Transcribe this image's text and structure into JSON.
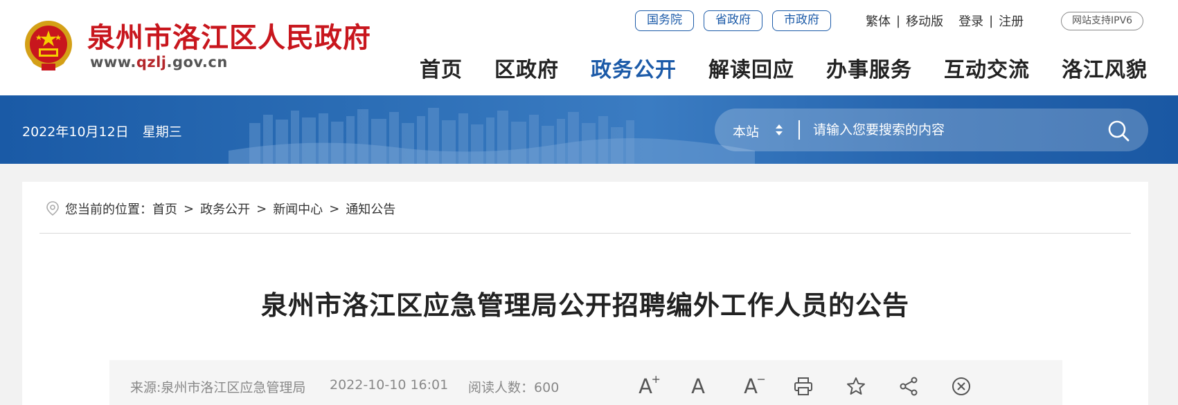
{
  "header": {
    "site_name": "泉州市洛江区人民政府",
    "site_url_prefix": "www.",
    "site_url_accent": "qzlj",
    "site_url_suffix": ".gov.cn",
    "gov_links": [
      "国务院",
      "省政府",
      "市政府"
    ],
    "util_links": {
      "traditional": "繁体",
      "mobile": "移动版",
      "login": "登录",
      "register": "注册",
      "separator": "|"
    },
    "ipv6_badge": "网站支持IPV6"
  },
  "nav": {
    "items": [
      {
        "label": "首页",
        "active": false
      },
      {
        "label": "区政府",
        "active": false
      },
      {
        "label": "政务公开",
        "active": true
      },
      {
        "label": "解读回应",
        "active": false
      },
      {
        "label": "办事服务",
        "active": false
      },
      {
        "label": "互动交流",
        "active": false
      },
      {
        "label": "洛江风貌",
        "active": false
      }
    ]
  },
  "banner": {
    "date": "2022年10月12日",
    "weekday": "星期三",
    "search": {
      "scope": "本站",
      "placeholder": "请输入您要搜索的内容",
      "icon": "search-icon"
    }
  },
  "breadcrumb": {
    "prefix": "您当前的位置：",
    "items": [
      "首页",
      "政务公开",
      "新闻中心",
      "通知公告"
    ],
    "separator": ">"
  },
  "article": {
    "title": "泉州市洛江区应急管理局公开招聘编外工作人员的公告",
    "source": "来源:泉州市洛江区应急管理局",
    "datetime": "2022-10-10 16:01",
    "views_label": "阅读人数：",
    "views": "600"
  },
  "tools": {
    "font_large": "A",
    "font_large_sup": "+",
    "font_normal": "A",
    "font_small": "A",
    "font_small_sup": "−",
    "icons": [
      "print-icon",
      "star-icon",
      "share-icon",
      "close-circle-icon"
    ]
  },
  "colors": {
    "brand_red": "#c8161d",
    "brand_blue": "#1b5aa8",
    "banner_blue": "#2b6db5",
    "page_bg": "#f2f2f2"
  }
}
